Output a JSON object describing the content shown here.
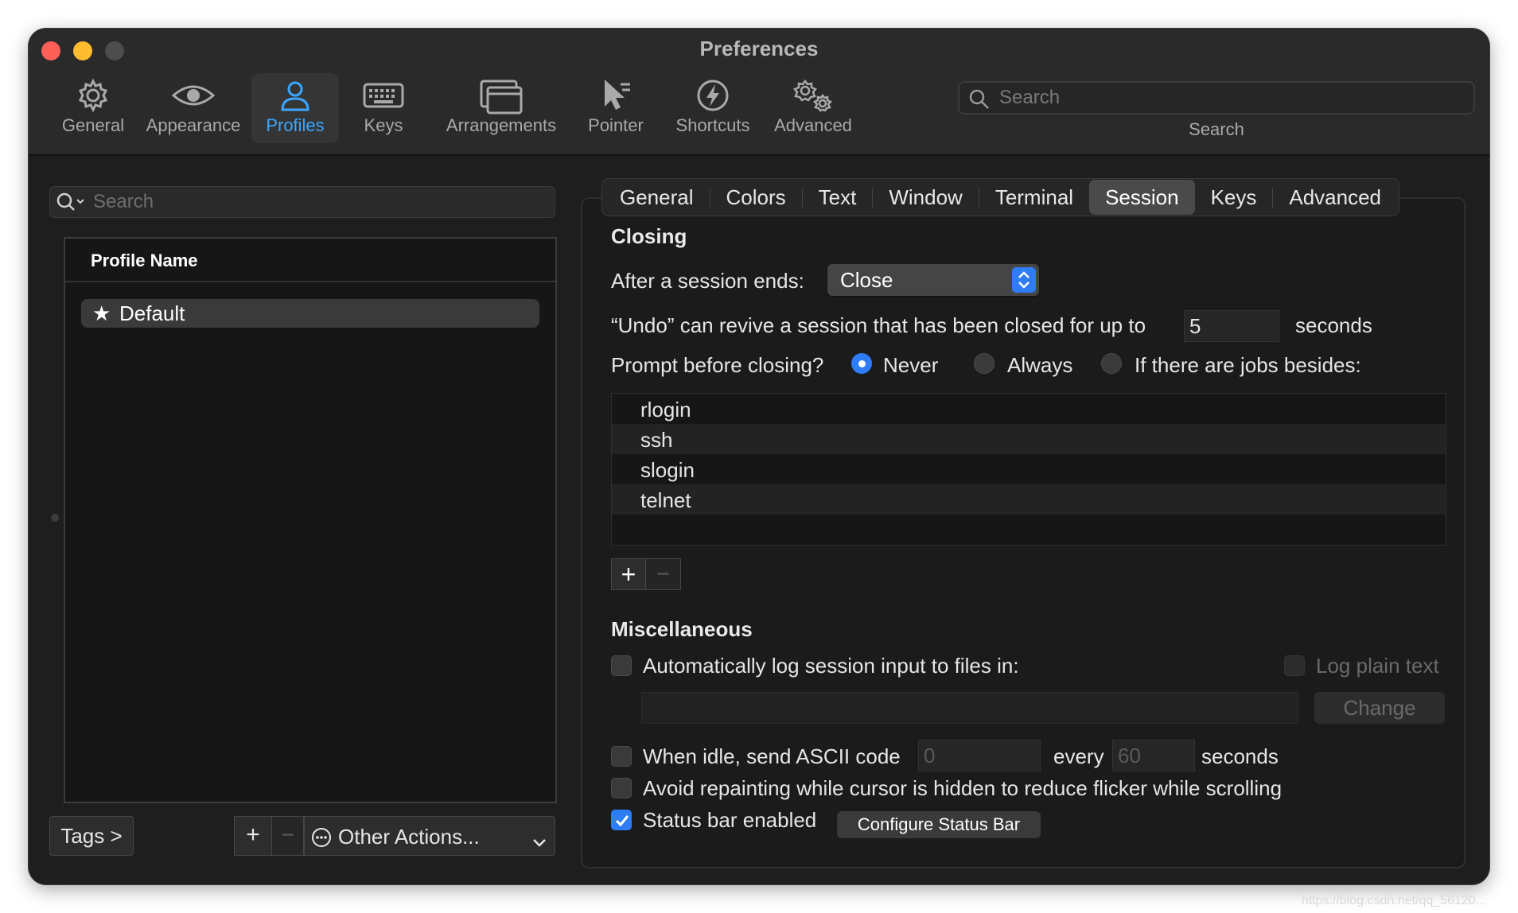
{
  "window": {
    "title": "Preferences"
  },
  "toolbar": {
    "items": [
      {
        "label": "General",
        "icon": "gear-icon"
      },
      {
        "label": "Appearance",
        "icon": "eye-icon"
      },
      {
        "label": "Profiles",
        "icon": "person-icon",
        "active": true
      },
      {
        "label": "Keys",
        "icon": "keyboard-icon"
      },
      {
        "label": "Arrangements",
        "icon": "windows-icon"
      },
      {
        "label": "Pointer",
        "icon": "cursor-icon"
      },
      {
        "label": "Shortcuts",
        "icon": "bolt-icon"
      },
      {
        "label": "Advanced",
        "icon": "gears-icon"
      }
    ],
    "search_placeholder": "Search",
    "search_label": "Search"
  },
  "profiles": {
    "search_placeholder": "Search",
    "column_header": "Profile Name",
    "items": [
      {
        "name": "Default",
        "is_default": true,
        "selected": true
      }
    ],
    "tags_label": "Tags >",
    "add_label": "+",
    "remove_label": "−",
    "other_actions_label": "Other Actions..."
  },
  "tabs": [
    {
      "label": "General"
    },
    {
      "label": "Colors"
    },
    {
      "label": "Text"
    },
    {
      "label": "Window"
    },
    {
      "label": "Terminal"
    },
    {
      "label": "Session",
      "active": true
    },
    {
      "label": "Keys"
    },
    {
      "label": "Advanced"
    }
  ],
  "closing": {
    "heading": "Closing",
    "after_ends_label": "After a session ends:",
    "after_ends_value": "Close",
    "undo_label": "“Undo” can revive a session that has been closed for up to",
    "undo_value": "5",
    "undo_unit": "seconds",
    "prompt_label": "Prompt before closing?",
    "prompt_options": [
      {
        "label": "Never",
        "selected": true
      },
      {
        "label": "Always",
        "selected": false
      },
      {
        "label": "If there are jobs besides:",
        "selected": false
      }
    ],
    "jobs": [
      "rlogin",
      "ssh",
      "slogin",
      "telnet"
    ],
    "add_label": "+",
    "remove_label": "−"
  },
  "misc": {
    "heading": "Miscellaneous",
    "auto_log_label": "Automatically log session input to files in:",
    "auto_log_checked": false,
    "log_plain_label": "Log plain text",
    "log_plain_checked": false,
    "change_label": "Change",
    "idle_label": "When idle, send ASCII code",
    "idle_checked": false,
    "idle_code": "0",
    "every_label": "every",
    "idle_interval": "60",
    "idle_unit": "seconds",
    "avoid_repaint_label": "Avoid repainting while cursor is hidden to reduce flicker while scrolling",
    "avoid_repaint_checked": false,
    "status_bar_label": "Status bar enabled",
    "status_bar_checked": true,
    "configure_label": "Configure Status Bar"
  },
  "watermark": "https://blog.csdn.net/qq_56120..."
}
